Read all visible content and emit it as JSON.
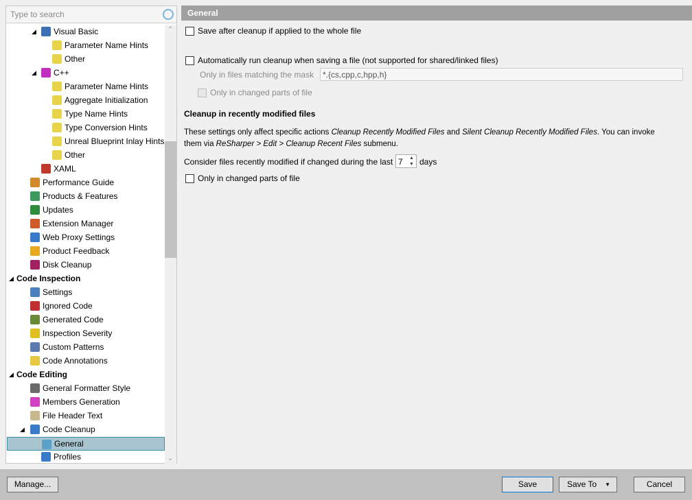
{
  "search": {
    "placeholder": "Type to search"
  },
  "tree": [
    {
      "label": "Visual Basic",
      "level": 2,
      "expanded": true,
      "icon": "visual-basic-icon",
      "color": "#3b6fb6"
    },
    {
      "label": "Parameter Name Hints",
      "level": 3,
      "icon": "inlay-hints-icon",
      "color": "#e8d44a"
    },
    {
      "label": "Other",
      "level": 3,
      "icon": "inlay-hints-icon",
      "color": "#e8d44a"
    },
    {
      "label": "C++",
      "level": 2,
      "expanded": true,
      "icon": "cpp-icon",
      "color": "#c02fc0"
    },
    {
      "label": "Parameter Name Hints",
      "level": 3,
      "icon": "inlay-hints-icon",
      "color": "#e8d44a"
    },
    {
      "label": "Aggregate Initialization",
      "level": 3,
      "icon": "inlay-hints-icon",
      "color": "#e8d44a"
    },
    {
      "label": "Type Name Hints",
      "level": 3,
      "icon": "inlay-hints-icon",
      "color": "#e8d44a"
    },
    {
      "label": "Type Conversion Hints",
      "level": 3,
      "icon": "inlay-hints-icon",
      "color": "#e8d44a"
    },
    {
      "label": "Unreal Blueprint Inlay Hints",
      "level": 3,
      "icon": "inlay-hints-icon",
      "color": "#e8d44a"
    },
    {
      "label": "Other",
      "level": 3,
      "icon": "inlay-hints-icon",
      "color": "#e8d44a"
    },
    {
      "label": "XAML",
      "level": 2,
      "icon": "xaml-icon",
      "color": "#c0392b"
    },
    {
      "label": "Performance Guide",
      "level": 1,
      "icon": "performance-guide-icon",
      "color": "#d08a2a"
    },
    {
      "label": "Products & Features",
      "level": 1,
      "icon": "products-features-icon",
      "color": "#3c9a5f"
    },
    {
      "label": "Updates",
      "level": 1,
      "icon": "updates-icon",
      "color": "#2e8b3a"
    },
    {
      "label": "Extension Manager",
      "level": 1,
      "icon": "extension-manager-icon",
      "color": "#d05a2a"
    },
    {
      "label": "Web Proxy Settings",
      "level": 1,
      "icon": "web-proxy-icon",
      "color": "#3a7ac8"
    },
    {
      "label": "Product Feedback",
      "level": 1,
      "icon": "envelope-icon",
      "color": "#e8a820"
    },
    {
      "label": "Disk Cleanup",
      "level": 1,
      "icon": "disk-cleanup-icon",
      "color": "#a02060"
    },
    {
      "label": "Code Inspection",
      "level": 0,
      "expanded": true,
      "bold": true
    },
    {
      "label": "Settings",
      "level": 1,
      "icon": "settings-icon",
      "color": "#4a7fc0"
    },
    {
      "label": "Ignored Code",
      "level": 1,
      "icon": "ignored-code-icon",
      "color": "#c03030"
    },
    {
      "label": "Generated Code",
      "level": 1,
      "icon": "generated-code-icon",
      "color": "#6a8a3a"
    },
    {
      "label": "Inspection Severity",
      "level": 1,
      "icon": "inspection-severity-icon",
      "color": "#e0c020"
    },
    {
      "label": "Custom Patterns",
      "level": 1,
      "icon": "custom-patterns-icon",
      "color": "#5a7ab0"
    },
    {
      "label": "Code Annotations",
      "level": 1,
      "icon": "code-annotations-icon",
      "color": "#e8c840"
    },
    {
      "label": "Code Editing",
      "level": 0,
      "expanded": true,
      "bold": true
    },
    {
      "label": "General Formatter Style",
      "level": 1,
      "icon": "formatter-style-icon",
      "color": "#6a6a6a"
    },
    {
      "label": "Members Generation",
      "level": 1,
      "icon": "members-generation-icon",
      "color": "#d040c0"
    },
    {
      "label": "File Header Text",
      "level": 1,
      "icon": "file-header-icon",
      "color": "#c8b890"
    },
    {
      "label": "Code Cleanup",
      "level": 1,
      "expanded": true,
      "icon": "code-cleanup-icon",
      "color": "#3a7ac8"
    },
    {
      "label": "General",
      "level": 2,
      "icon": "wrench-icon",
      "color": "#5aa0c8",
      "selected": true
    },
    {
      "label": "Profiles",
      "level": 2,
      "icon": "code-cleanup-icon",
      "color": "#3a7ac8"
    }
  ],
  "panel": {
    "title": "General",
    "save_after": {
      "label": "Save after cleanup if applied to the whole file",
      "checked": false
    },
    "auto_run": {
      "label": "Automatically run cleanup when saving a file (not supported for shared/linked files)",
      "checked": false
    },
    "mask_label": "Only in files matching the mask",
    "mask_value": "*.{cs,cpp,c,hpp,h}",
    "auto_changed_only": {
      "label": "Only in changed parts of file",
      "checked": false
    },
    "section_title": "Cleanup in recently modified files",
    "desc1_a": "These settings only affect specific actions ",
    "desc1_b": "Cleanup Recently Modified Files",
    "desc1_c": " and ",
    "desc1_d": "Silent Cleanup Recently Modified Files",
    "desc1_e": ". You can invoke",
    "desc2_a": "them via ",
    "desc2_b": "ReSharper > Edit > Cleanup Recent Files",
    "desc2_c": " submenu.",
    "days_label": "Consider files recently modified if changed during the last",
    "days_value": "7",
    "days_unit": "days",
    "recent_changed_only": {
      "label": "Only in changed parts of file",
      "checked": false
    }
  },
  "buttons": {
    "manage": "Manage...",
    "save": "Save",
    "save_to": "Save To",
    "cancel": "Cancel"
  }
}
